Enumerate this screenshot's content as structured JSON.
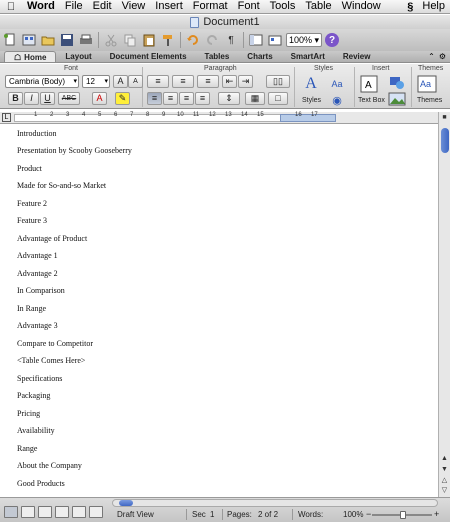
{
  "menubar": {
    "items": [
      "Word",
      "File",
      "Edit",
      "View",
      "Insert",
      "Format",
      "Font",
      "Tools",
      "Table",
      "Window",
      "Help"
    ]
  },
  "window": {
    "title": "Document1"
  },
  "toolbar": {
    "zoom": "100%",
    "help": "?"
  },
  "ribbon": {
    "tabs": [
      "Home",
      "Layout",
      "Document Elements",
      "Tables",
      "Charts",
      "SmartArt",
      "Review"
    ],
    "active_tab": "Home",
    "groups": [
      "Font",
      "Paragraph",
      "Styles",
      "Insert",
      "Themes"
    ],
    "font_name": "Cambria (Body)",
    "font_size": "12",
    "format_buttons": [
      "B",
      "I",
      "U",
      "ABC"
    ],
    "styles_label": "Styles",
    "text_box_label": "Text Box",
    "themes_label": "Themes"
  },
  "ruler": {
    "numbers": [
      "1",
      "2",
      "3",
      "4",
      "5",
      "6",
      "7",
      "8",
      "9",
      "10",
      "11",
      "12",
      "13",
      "14",
      "15",
      "16",
      "17"
    ]
  },
  "document": {
    "paragraphs": [
      "Introduction",
      "Presentation by Scooby Gooseberry",
      "Product",
      "Made for So-and-so Market",
      "Feature 2",
      "Feature 3",
      "Advantage of Product",
      "Advantage 1",
      "Advantage 2",
      "In Comparison",
      "In Range",
      "Advantage 3",
      "Compare to Competitor",
      "<Table Comes Here>",
      "Specifications",
      "Packaging",
      "Pricing",
      "Availability",
      "Range",
      "About the Company",
      "Good Products"
    ]
  },
  "statusbar": {
    "view": "Draft View",
    "sec_label": "Sec",
    "sec_value": "1",
    "pages_label": "Pages:",
    "pages_value": "2 of 2",
    "words_label": "Words:",
    "zoom": "100%"
  },
  "colors": {
    "accent": "#3d66c3",
    "help": "#7b55c9"
  }
}
